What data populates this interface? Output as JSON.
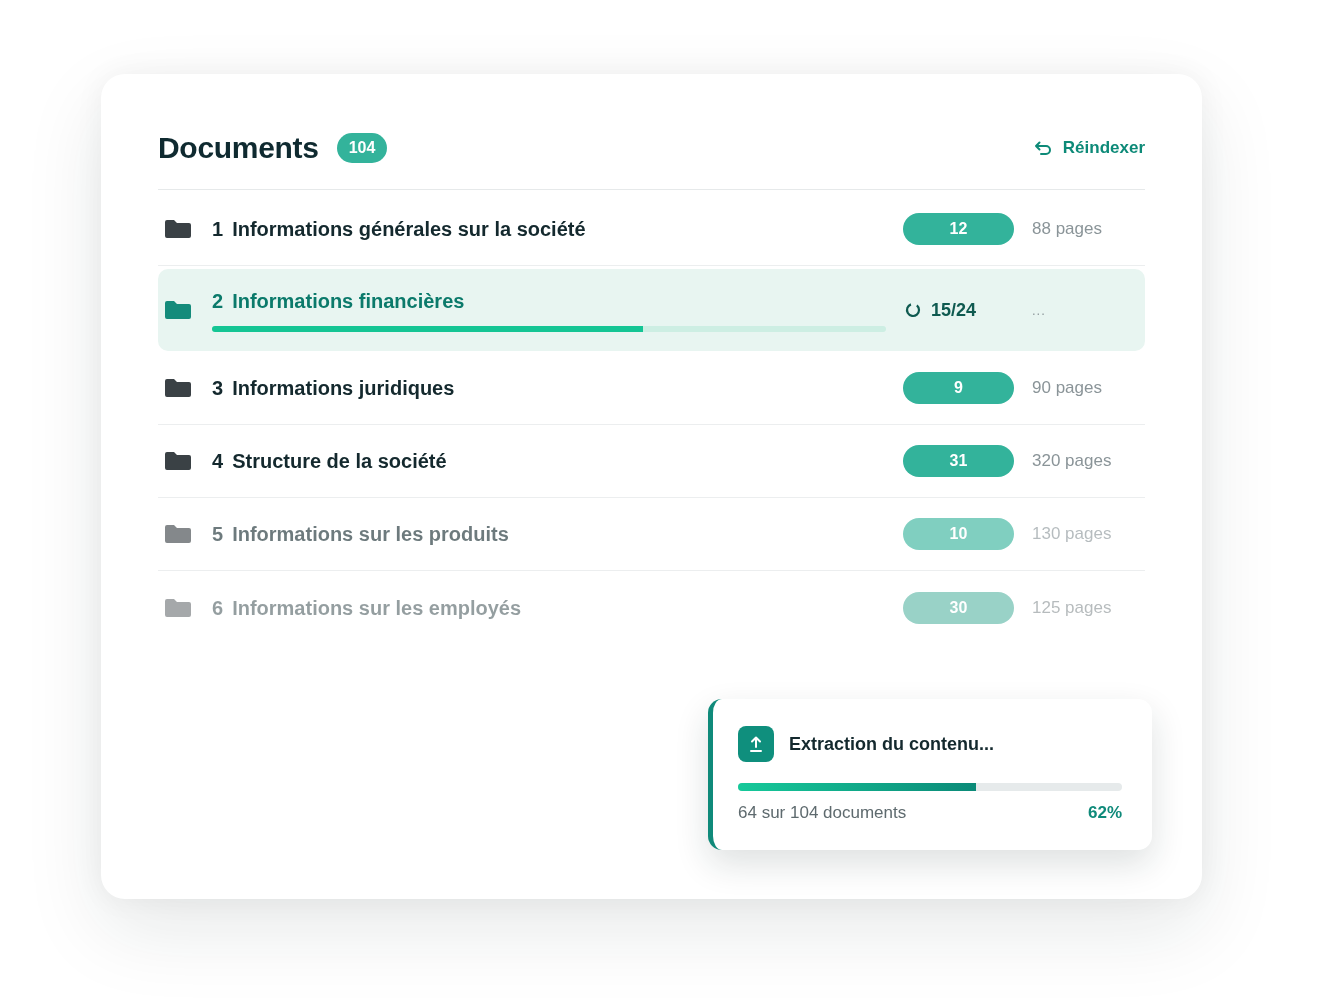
{
  "header": {
    "title": "Documents",
    "count": "104",
    "action": "Réindexer"
  },
  "folders": [
    {
      "number": "1",
      "title": "Informations générales sur la société",
      "kind": "done",
      "files": "12",
      "pages": "88 pages"
    },
    {
      "number": "2",
      "title": "Informations financières",
      "kind": "processing",
      "level": 0.64,
      "progress": "15/24",
      "pages": "..."
    },
    {
      "number": "3",
      "title": "Informations juridiques",
      "kind": "done",
      "files": "9",
      "pages": "90 pages"
    },
    {
      "number": "4",
      "title": "Structure de la société",
      "kind": "done",
      "files": "31",
      "pages": "320 pages"
    },
    {
      "number": "5",
      "title": "Informations sur les produits",
      "kind": "pending",
      "files": "10",
      "pages": "130 pages"
    },
    {
      "number": "6",
      "title": "Informations sur les employés",
      "kind": "queued",
      "files": "30",
      "pages": "125 pages"
    }
  ],
  "toast": {
    "title": "Extraction du contenu...",
    "level": 0.62,
    "count": "64 sur 104 documents",
    "percent": "62%"
  }
}
